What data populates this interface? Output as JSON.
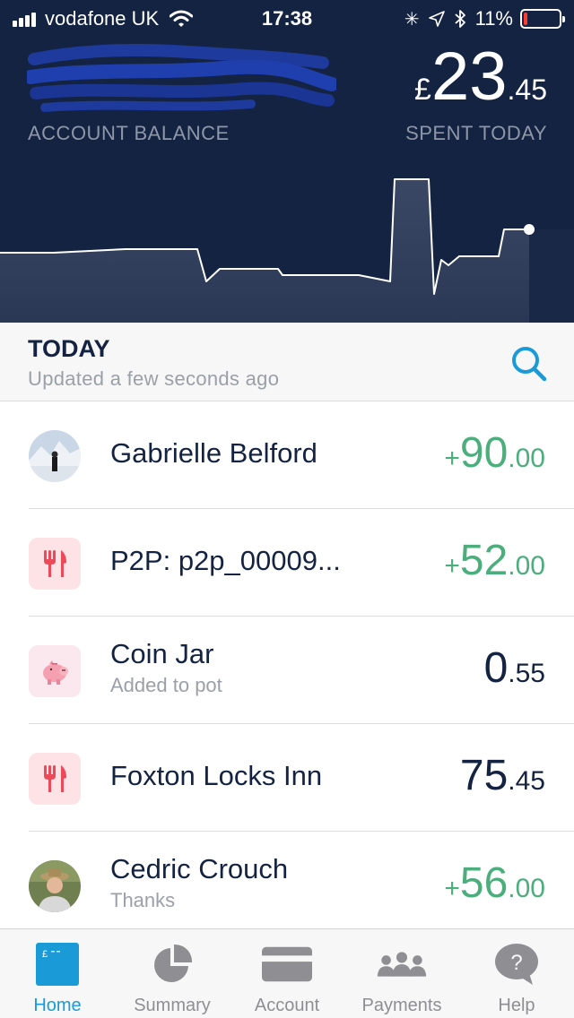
{
  "status_bar": {
    "carrier": "vodafone UK",
    "time": "17:38",
    "battery": "11%",
    "battery_level": 0.11
  },
  "header": {
    "account_balance_label": "ACCOUNT BALANCE",
    "spent": {
      "currency": "£",
      "major": "23",
      "minor": ".45"
    },
    "spent_label": "SPENT TODAY"
  },
  "section": {
    "title": "TODAY",
    "subtitle": "Updated a few seconds ago"
  },
  "transactions": [
    {
      "name": "Gabrielle Belford",
      "note": "",
      "sign": "+",
      "major": "90",
      "minor": ".00",
      "icon": "person-avatar"
    },
    {
      "name": "P2P: p2p_00009...",
      "note": "",
      "sign": "+",
      "major": "52",
      "minor": ".00",
      "icon": "eating-out-icon"
    },
    {
      "name": "Coin Jar",
      "note": "Added to pot",
      "sign": "",
      "major": "0",
      "minor": ".55",
      "icon": "piggy-bank-icon"
    },
    {
      "name": "Foxton Locks Inn",
      "note": "",
      "sign": "",
      "major": "75",
      "minor": ".45",
      "icon": "eating-out-icon"
    },
    {
      "name": "Cedric Crouch",
      "note": "Thanks",
      "sign": "+",
      "major": "56",
      "minor": ".00",
      "icon": "person-avatar"
    }
  ],
  "tabs": [
    {
      "label": "Home",
      "icon": "card-icon",
      "active": true
    },
    {
      "label": "Summary",
      "icon": "pie-chart-icon",
      "active": false
    },
    {
      "label": "Account",
      "icon": "account-card-icon",
      "active": false
    },
    {
      "label": "Payments",
      "icon": "people-icon",
      "active": false
    },
    {
      "label": "Help",
      "icon": "help-bubble-icon",
      "active": false
    }
  ],
  "colors": {
    "header_bg": "#142341",
    "credit": "#4cae7c",
    "accent": "#1a9bd7",
    "category_bg": "#fde3e6",
    "category_fg": "#ea4a5a"
  }
}
